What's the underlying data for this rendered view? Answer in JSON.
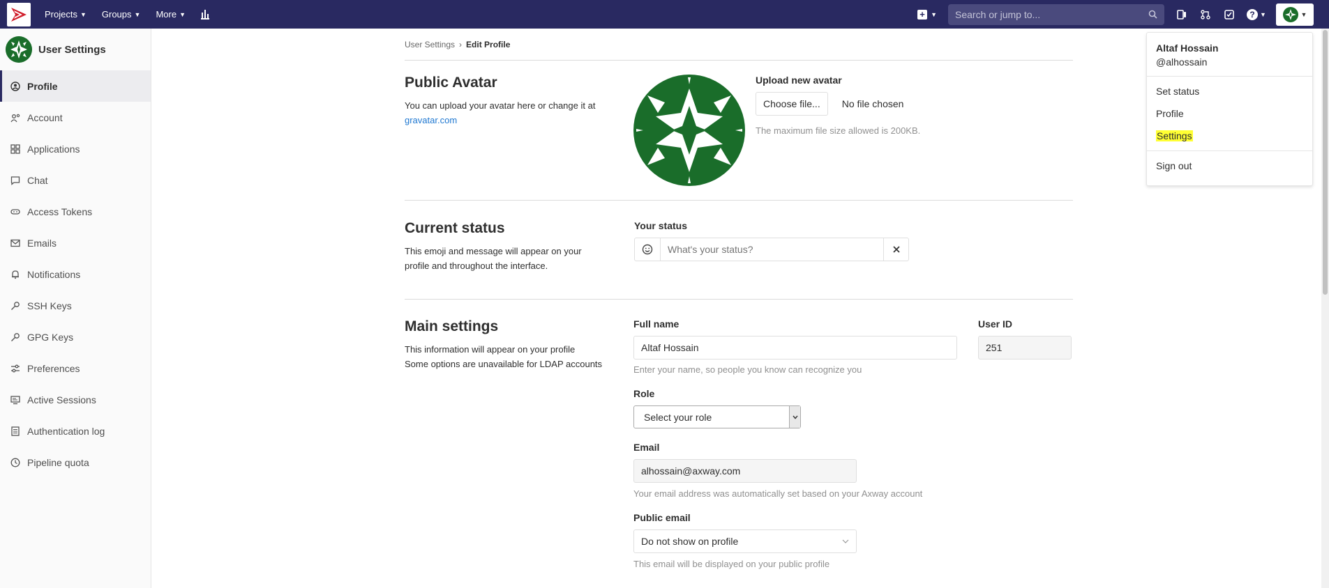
{
  "topbar": {
    "nav": [
      {
        "label": "Projects"
      },
      {
        "label": "Groups"
      },
      {
        "label": "More"
      }
    ],
    "search_placeholder": "Search or jump to...",
    "colors": {
      "navbar": "#292961",
      "accent": "#1f78d1"
    }
  },
  "sidebar": {
    "title": "User Settings",
    "items": [
      {
        "label": "Profile",
        "icon": "user-circle-icon"
      },
      {
        "label": "Account",
        "icon": "user-gear-icon"
      },
      {
        "label": "Applications",
        "icon": "grid-icon"
      },
      {
        "label": "Chat",
        "icon": "chat-icon"
      },
      {
        "label": "Access Tokens",
        "icon": "token-icon"
      },
      {
        "label": "Emails",
        "icon": "mail-icon"
      },
      {
        "label": "Notifications",
        "icon": "bell-icon"
      },
      {
        "label": "SSH Keys",
        "icon": "key-icon"
      },
      {
        "label": "GPG Keys",
        "icon": "key-icon"
      },
      {
        "label": "Preferences",
        "icon": "sliders-icon"
      },
      {
        "label": "Active Sessions",
        "icon": "monitor-icon"
      },
      {
        "label": "Authentication log",
        "icon": "list-icon"
      },
      {
        "label": "Pipeline quota",
        "icon": "clock-icon"
      }
    ]
  },
  "breadcrumb": {
    "parent": "User Settings",
    "separator": "›",
    "current": "Edit Profile"
  },
  "avatar_section": {
    "title": "Public Avatar",
    "desc": "You can upload your avatar here or change it at",
    "link": "gravatar.com",
    "upload_label": "Upload new avatar",
    "choose_button": "Choose file...",
    "no_file": "No file chosen",
    "max_size": "The maximum file size allowed is 200KB."
  },
  "status_section": {
    "title": "Current status",
    "desc": "This emoji and message will appear on your profile and throughout the interface.",
    "label": "Your status",
    "placeholder": "What's your status?"
  },
  "main_section": {
    "title": "Main settings",
    "desc_line1": "This information will appear on your profile",
    "desc_line2": "Some options are unavailable for LDAP accounts",
    "full_name_label": "Full name",
    "full_name_value": "Altaf Hossain",
    "full_name_help": "Enter your name, so people you know can recognize you",
    "user_id_label": "User ID",
    "user_id_value": "251",
    "role_label": "Role",
    "role_value": "Select your role",
    "email_label": "Email",
    "email_value": "alhossain@axway.com",
    "email_help": "Your email address was automatically set based on your Axway account",
    "public_email_label": "Public email",
    "public_email_value": "Do not show on profile",
    "public_email_help": "This email will be displayed on your public profile"
  },
  "user_menu": {
    "name": "Altaf Hossain",
    "handle": "@alhossain",
    "items": [
      "Set status",
      "Profile",
      "Settings"
    ],
    "signout": "Sign out"
  }
}
